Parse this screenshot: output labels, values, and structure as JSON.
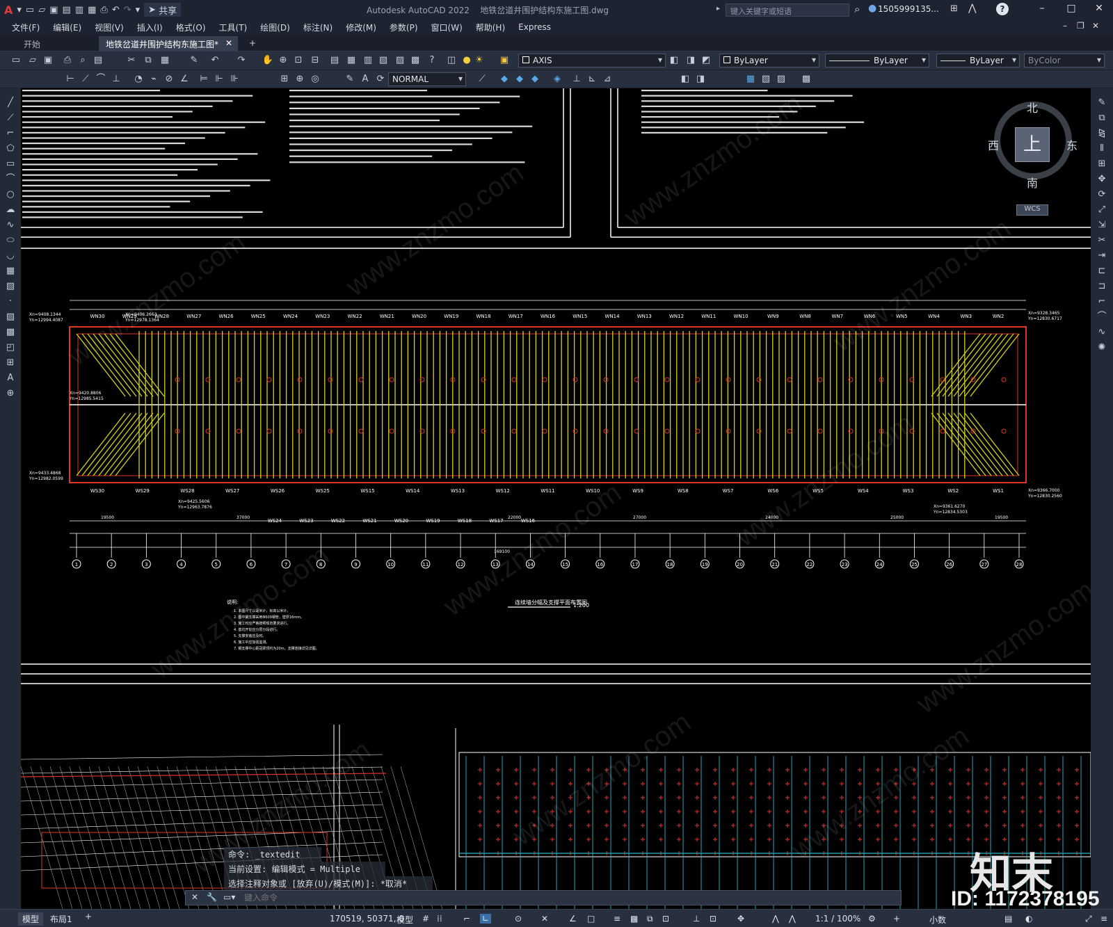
{
  "app": {
    "title": "Autodesk AutoCAD 2022",
    "document": "地铁岔道井围护结构东施工图.dwg",
    "share": "共享",
    "search_placeholder": "键入关键字或短语",
    "user": "1505999135...",
    "app_logo": "A"
  },
  "menu": [
    "文件(F)",
    "编辑(E)",
    "视图(V)",
    "插入(I)",
    "格式(O)",
    "工具(T)",
    "绘图(D)",
    "标注(N)",
    "修改(M)",
    "参数(P)",
    "窗口(W)",
    "帮助(H)",
    "Express"
  ],
  "tabs": {
    "start": "开始",
    "doc": "地铁岔道井围护结构东施工图*",
    "add": "+"
  },
  "toolbar": {
    "layer": "AXIS",
    "color": "ByLayer",
    "linetype": "ByLayer",
    "lineweight": "ByLayer",
    "plotstyle": "ByColor",
    "textstyle": "NORMAL"
  },
  "viewcube": {
    "north": "北",
    "south": "南",
    "east": "东",
    "west": "西",
    "top": "上",
    "wcs": "WCS"
  },
  "drawing": {
    "plan_title": "连续墙分幅及支撑平面布置图",
    "plan_scale": "1:200",
    "notes_title": "说明:",
    "notes": [
      "1. 本图尺寸以毫米计，标高以米计。",
      "2. 图中钢支撑采用Φ609钢管，壁厚16mm。",
      "3. 施工时应严格按照规范要求进行。",
      "4. 基坑开挖应分层分段进行。",
      "5. 支撑安装应及时。",
      "6. 施工中应加强监测。",
      "7. 钢支撑中心距冠梁顶约为20m，支撑连接详见详图。"
    ],
    "north_walls": [
      "WN30",
      "WN29",
      "WN28",
      "WN27",
      "WN26",
      "WN25",
      "WN24",
      "WN23",
      "WN22",
      "WN21",
      "WN20",
      "WN19",
      "WN18",
      "WN17",
      "WN16",
      "WN15",
      "WN14",
      "WN13",
      "WN12",
      "WN11",
      "WN10",
      "WN9",
      "WN8",
      "WN7",
      "WN6",
      "WN5",
      "WN4",
      "WN3",
      "WN2"
    ],
    "south_walls": [
      "WS30",
      "WS29",
      "WS28",
      "WS27",
      "WS26",
      "WS25",
      "WS15",
      "WS14",
      "WS13",
      "WS12",
      "WS11",
      "WS10",
      "WS9",
      "WS8",
      "WS7",
      "WS6",
      "WS5",
      "WS4",
      "WS3",
      "WS2",
      "WS1"
    ],
    "south_walls_lower": [
      "WS24",
      "WS23",
      "WS22",
      "WS21",
      "WS20",
      "WS19",
      "WS18",
      "WS17",
      "WS16"
    ],
    "axes": [
      "1",
      "2",
      "3",
      "4",
      "5",
      "6",
      "7",
      "8",
      "9",
      "10",
      "11",
      "12",
      "13",
      "14",
      "15",
      "16",
      "17",
      "18",
      "19",
      "20",
      "21",
      "22",
      "23",
      "24",
      "25",
      "26",
      "27",
      "28"
    ],
    "coords": [
      "Xn=9408.1344",
      "Yn=12994.4087",
      "Xn=9406.2663",
      "Yn=12978.1364",
      "Xn=9420.8806",
      "Yn=12985.5415",
      "Xn=9433.4868",
      "Yn=12982.0599",
      "Xn=9425.5606",
      "Yn=12963.7876",
      "Xn=9328.3465",
      "Yn=12830.6717",
      "Xn=9361.6270",
      "Yn=12834.5303",
      "Xn=9366.7000",
      "Yn=12830.2560"
    ],
    "dims": [
      "19500",
      "37000",
      "22000",
      "27000",
      "24000",
      "25000",
      "19500",
      "169100"
    ]
  },
  "command": {
    "line1": "命令:  _textedit",
    "line2": "当前设置: 编辑模式 = Multiple",
    "line3": "选择注释对象或 [放弃(U)/模式(M)]: *取消*",
    "prompt": "键入命令"
  },
  "status": {
    "coords": "170519, 50371, 0",
    "model_btn": "模型",
    "scale": "1:1 / 100%",
    "units": "小数",
    "layout_tabs": [
      "模型",
      "布局1"
    ]
  },
  "watermark": {
    "brand": "知末",
    "id": "ID: 1172378195",
    "url": "www.znzmo.com"
  }
}
